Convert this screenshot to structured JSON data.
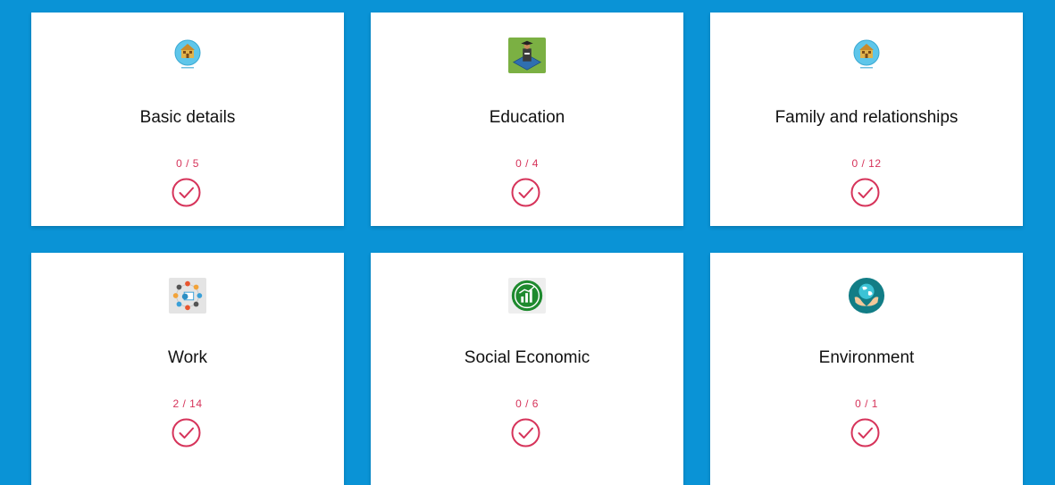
{
  "colors": {
    "background": "#0a93d6",
    "card": "#ffffff",
    "accent": "#d6335a"
  },
  "cards": [
    {
      "title": "Basic details",
      "progress": "0 / 5",
      "icon": "house-badge-icon"
    },
    {
      "title": "Education",
      "progress": "0 / 4",
      "icon": "graduate-tile-icon"
    },
    {
      "title": "Family and relationships",
      "progress": "0 / 12",
      "icon": "house-badge-icon"
    },
    {
      "title": "Work",
      "progress": "2 / 14",
      "icon": "work-cycle-icon"
    },
    {
      "title": "Social Economic",
      "progress": "0 / 6",
      "icon": "economy-growth-icon"
    },
    {
      "title": "Environment",
      "progress": "0 / 1",
      "icon": "globe-hands-icon"
    }
  ]
}
